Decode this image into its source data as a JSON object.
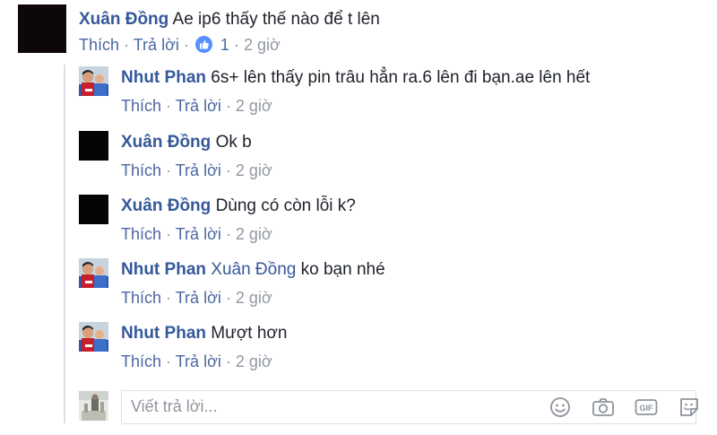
{
  "main_comment": {
    "author": "Xuân Đồng",
    "text": "Ae ip6 thấy thế nào để t lên",
    "like": "Thích",
    "reply": "Trả lời",
    "sep1": "·",
    "reaction_count": "1",
    "sep2": "·",
    "time": "2 giờ"
  },
  "replies": [
    {
      "author": "Nhut Phan",
      "text": "6s+ lên thấy pin trâu hẳn ra.6 lên đi bạn.ae lên hết",
      "like": "Thích",
      "reply": "Trả lời",
      "sep1": "·",
      "sep2": "·",
      "time": "2 giờ"
    },
    {
      "author": "Xuân Đồng",
      "text": "Ok b",
      "like": "Thích",
      "reply": "Trả lời",
      "sep1": "·",
      "sep2": "·",
      "time": "2 giờ"
    },
    {
      "author": "Xuân Đồng",
      "text": "Dùng có còn lỗi k?",
      "like": "Thích",
      "reply": "Trả lời",
      "sep1": "·",
      "sep2": "·",
      "time": "2 giờ"
    },
    {
      "author": "Nhut Phan",
      "mention": "Xuân Đồng",
      "text": "ko bạn nhé",
      "like": "Thích",
      "reply": "Trả lời",
      "sep1": "·",
      "sep2": "·",
      "time": "2 giờ"
    },
    {
      "author": "Nhut Phan",
      "text": "Mượt hơn",
      "like": "Thích",
      "reply": "Trả lời",
      "sep1": "·",
      "sep2": "·",
      "time": "2 giờ"
    }
  ],
  "composer": {
    "placeholder": "Viết trả lời...",
    "icons": [
      "emoji-icon",
      "camera-icon",
      "gif-icon",
      "sticker-icon"
    ]
  },
  "colors": {
    "name": "#365899",
    "text": "#1d2129",
    "meta": "#9197a3",
    "like_badge": "#5890ff"
  }
}
